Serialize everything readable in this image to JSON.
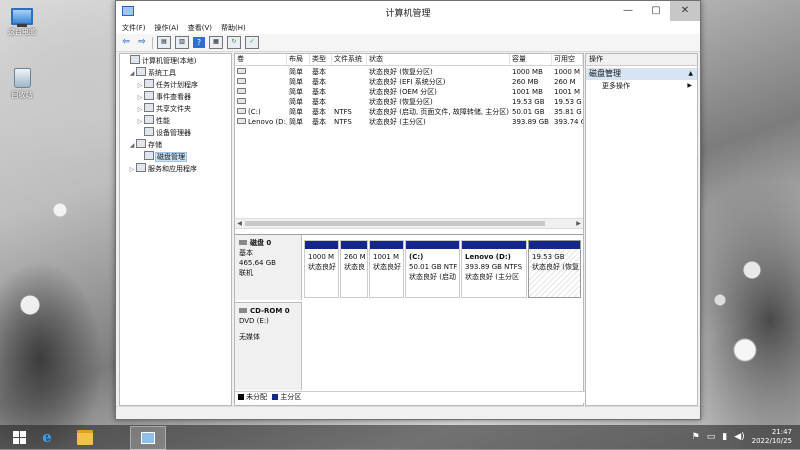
{
  "desktop": {
    "icons": [
      {
        "label": "这台电脑"
      },
      {
        "label": "回收站"
      }
    ]
  },
  "window": {
    "title": "计算机管理",
    "controls": {
      "minimize": "—",
      "maximize": "▢",
      "close": "✕"
    },
    "menu": [
      "文件(F)",
      "操作(A)",
      "查看(V)",
      "帮助(H)"
    ]
  },
  "tree": {
    "items": [
      {
        "label": "计算机管理(本地)",
        "indent": 0,
        "arrow": "",
        "icon": "computer-management-icon"
      },
      {
        "label": "系统工具",
        "indent": 1,
        "arrow": "◢",
        "icon": "tools-icon"
      },
      {
        "label": "任务计划程序",
        "indent": 2,
        "arrow": "▷",
        "icon": "clock-icon"
      },
      {
        "label": "事件查看器",
        "indent": 2,
        "arrow": "▷",
        "icon": "event-viewer-icon"
      },
      {
        "label": "共享文件夹",
        "indent": 2,
        "arrow": "▷",
        "icon": "shared-folder-icon"
      },
      {
        "label": "性能",
        "indent": 2,
        "arrow": "▷",
        "icon": "performance-icon"
      },
      {
        "label": "设备管理器",
        "indent": 2,
        "arrow": "",
        "icon": "device-manager-icon"
      },
      {
        "label": "存储",
        "indent": 1,
        "arrow": "◢",
        "icon": "storage-icon"
      },
      {
        "label": "磁盘管理",
        "indent": 2,
        "arrow": "",
        "icon": "disk-management-icon",
        "selected": true
      },
      {
        "label": "服务和应用程序",
        "indent": 1,
        "arrow": "▷",
        "icon": "services-icon"
      }
    ]
  },
  "volumes": {
    "headers": [
      "卷",
      "布局",
      "类型",
      "文件系统",
      "状态",
      "容量",
      "可用空"
    ],
    "rows": [
      {
        "vol": "",
        "layout": "简单",
        "type": "基本",
        "fs": "",
        "status": "状态良好 (恢复分区)",
        "cap": "1000 MB",
        "free": "1000 M"
      },
      {
        "vol": "",
        "layout": "简单",
        "type": "基本",
        "fs": "",
        "status": "状态良好 (EFI 系统分区)",
        "cap": "260 MB",
        "free": "260 M"
      },
      {
        "vol": "",
        "layout": "简单",
        "type": "基本",
        "fs": "",
        "status": "状态良好 (OEM 分区)",
        "cap": "1001 MB",
        "free": "1001 M"
      },
      {
        "vol": "",
        "layout": "简单",
        "type": "基本",
        "fs": "",
        "status": "状态良好 (恢复分区)",
        "cap": "19.53 GB",
        "free": "19.53 G"
      },
      {
        "vol": "(C:)",
        "layout": "简单",
        "type": "基本",
        "fs": "NTFS",
        "status": "状态良好 (启动, 页面文件, 故障转储, 主分区)",
        "cap": "50.01 GB",
        "free": "35.81 G"
      },
      {
        "vol": "Lenovo (D:)",
        "layout": "简单",
        "type": "基本",
        "fs": "NTFS",
        "status": "状态良好 (主分区)",
        "cap": "393.89 GB",
        "free": "393.74 G"
      }
    ]
  },
  "disk0": {
    "name": "磁盘 0",
    "type": "基本",
    "size": "465.64 GB",
    "state": "联机",
    "partitions": [
      {
        "line1": "",
        "line2": "1000 M",
        "line3": "状态良好"
      },
      {
        "line1": "",
        "line2": "260 M",
        "line3": "状态良"
      },
      {
        "line1": "",
        "line2": "1001 M",
        "line3": "状态良好"
      },
      {
        "line1": "(C:)",
        "line2": "50.01 GB NTF",
        "line3": "状态良好 (启动"
      },
      {
        "line1": "Lenovo  (D:)",
        "line2": "393.89 GB NTFS",
        "line3": "状态良好 (主分区"
      },
      {
        "line1": "",
        "line2": "19.53 GB",
        "line3": "状态良好 (恢复"
      }
    ]
  },
  "cdrom0": {
    "name": "CD-ROM 0",
    "type": "DVD (E:)",
    "state": "无媒体"
  },
  "legend": {
    "unallocated": "未分配",
    "primary": "主分区",
    "colors": {
      "unallocated": "#000000",
      "primary": "#13288a"
    }
  },
  "actions": {
    "header": "操作",
    "section": "磁盘管理",
    "more": "更多操作"
  },
  "taskbar": {
    "time": "21:47",
    "date": "2022/10/25"
  }
}
